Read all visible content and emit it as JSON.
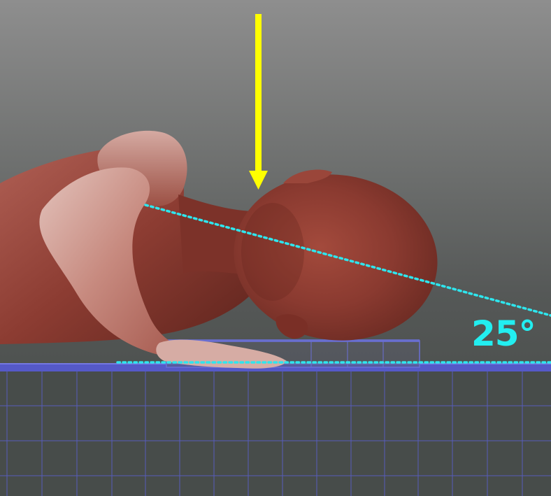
{
  "scene": {
    "angle_label": "25°",
    "angle_degrees": 25,
    "colors": {
      "arrow": "#ffff00",
      "guide_lines": "#2ee6ee",
      "angle_text": "#22eef0",
      "floor_grid": "#5a5fcf",
      "floor_edge": "#5559c8",
      "figure_skin": "#8a3a30"
    },
    "icons": {
      "arrow": "down-arrow-icon"
    }
  }
}
